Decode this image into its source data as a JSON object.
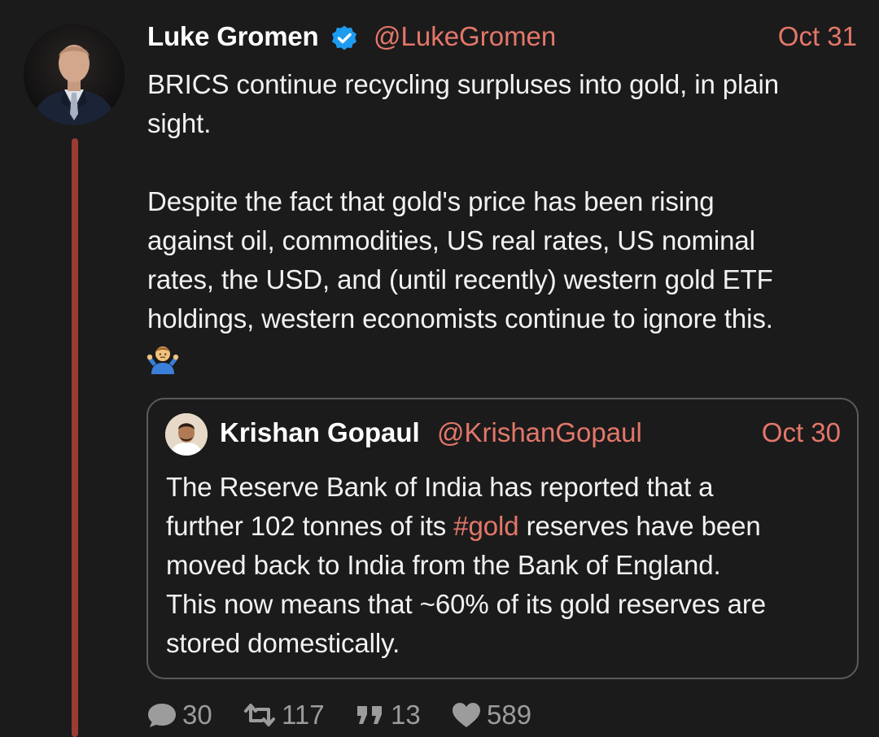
{
  "tweet": {
    "author_name": "Luke Gromen",
    "handle": "@LukeGromen",
    "date": "Oct 31",
    "verified": true,
    "lines": [
      "BRICS continue recycling surpluses into gold, in plain",
      "sight.",
      "Despite the fact that gold's price has been rising",
      "against oil, commodities, US real rates, US nominal",
      "rates, the USD, and (until recently) western gold ETF",
      "holdings, western economists continue to ignore this."
    ],
    "emoji": "person-shrugging"
  },
  "quote": {
    "author_name": "Krishan Gopaul",
    "handle": "@KrishanGopaul",
    "date": "Oct 30",
    "line1": "The Reserve Bank of India has reported that a",
    "line2_before": "further 102 tonnes of its ",
    "hashtag": "#gold",
    "line2_after": " reserves have been",
    "line3": "moved back to India from the Bank of England.",
    "line4": "This now means that ~60% of its gold reserves are",
    "line5": "stored domestically."
  },
  "actions": {
    "replies": "30",
    "retweets": "117",
    "quotes": "13",
    "likes": "589"
  },
  "colors": {
    "background": "#1c1b1b",
    "accent": "#e3776a",
    "thread_line": "#9a3c33",
    "muted": "#9c9c9c",
    "verified": "#1d9bf0"
  },
  "icons": {
    "reply": "speech-bubble-icon",
    "retweet": "retweet-icon",
    "quote": "quote-marks-icon",
    "like": "heart-icon",
    "verified": "verified-badge-icon"
  }
}
